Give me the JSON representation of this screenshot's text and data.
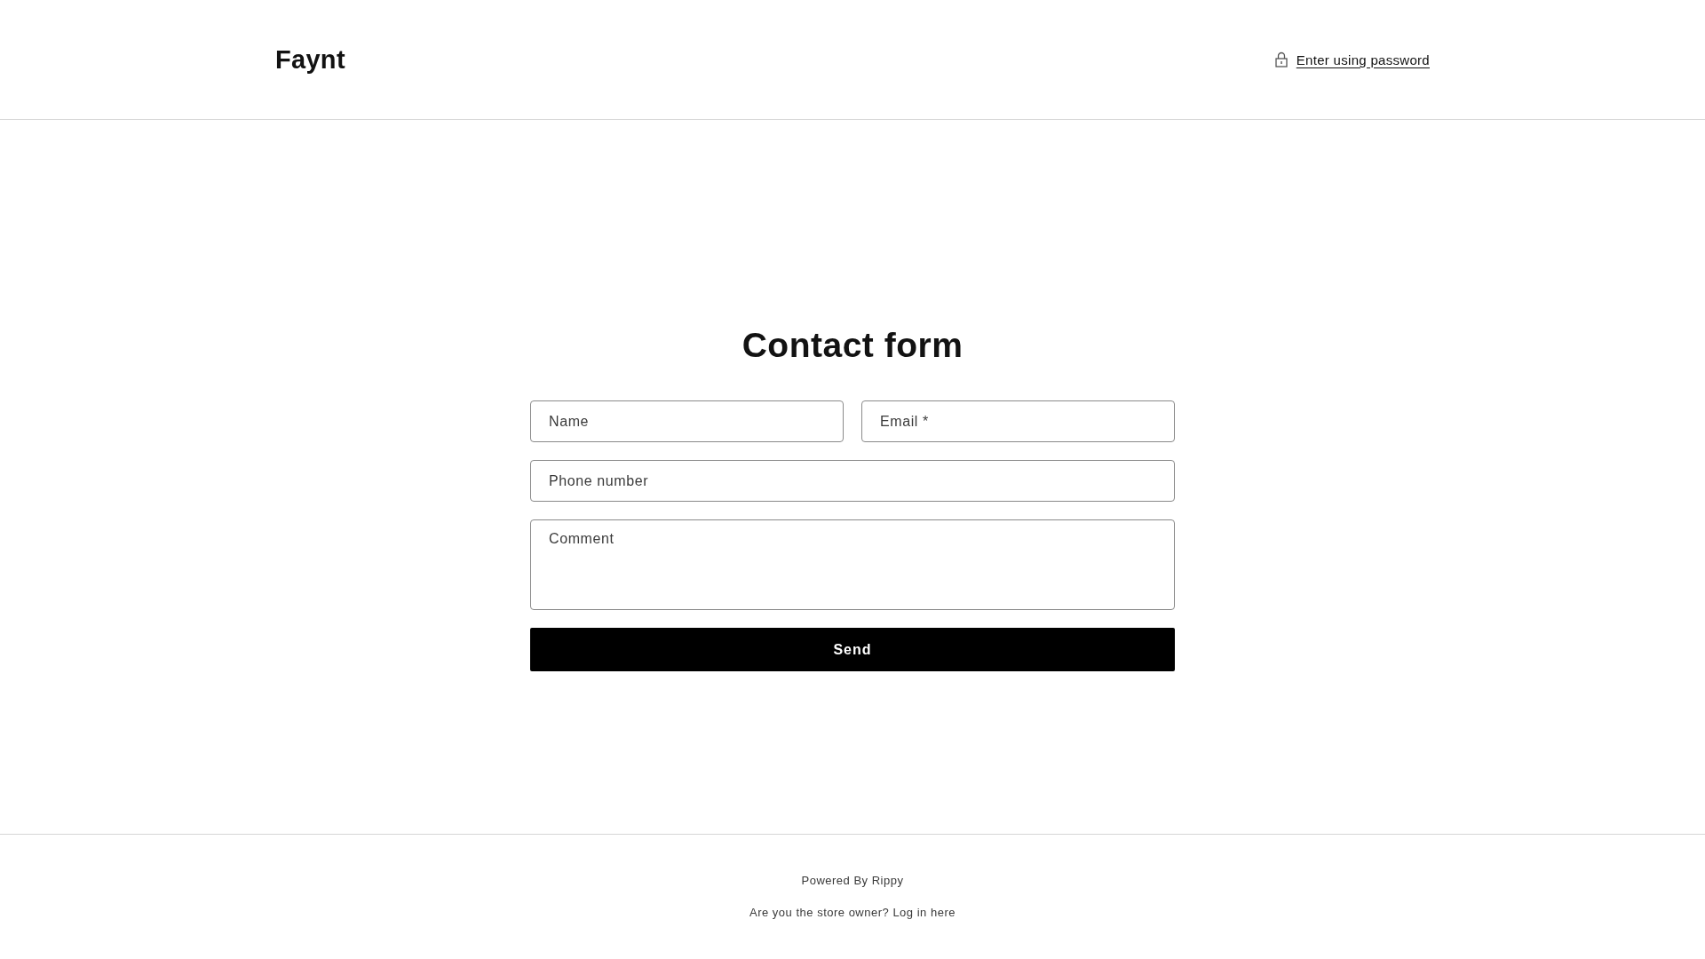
{
  "header": {
    "logo": "Faynt",
    "password_link": "Enter using password"
  },
  "form": {
    "title": "Contact form",
    "fields": [
      {
        "kind": "input",
        "placeholder": "Name"
      },
      {
        "kind": "input",
        "placeholder": "Email *"
      },
      {
        "kind": "input",
        "placeholder": "Phone number"
      },
      {
        "kind": "textarea",
        "placeholder": "Comment"
      }
    ],
    "submit": "Send"
  },
  "footer": {
    "powered_by": "Powered By Rippy",
    "owner_login": "Are you the store owner? Log in here"
  }
}
